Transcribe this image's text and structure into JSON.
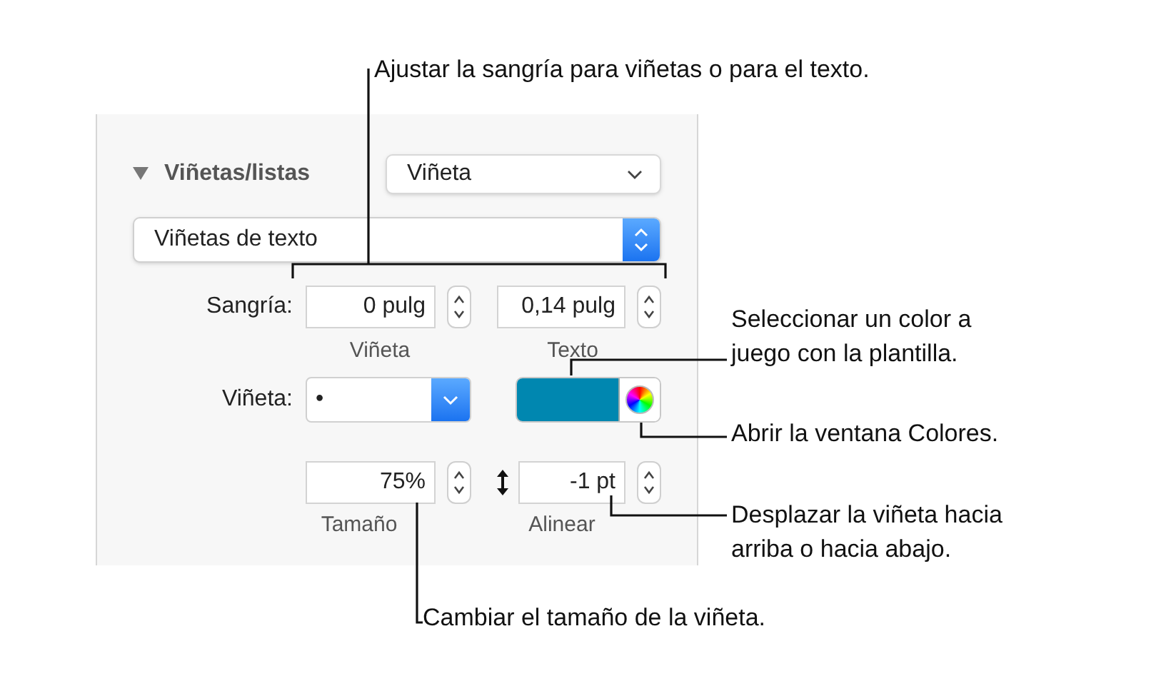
{
  "section": {
    "title": "Viñetas/listas",
    "expanded": true,
    "style_popup": "Viñeta"
  },
  "bullet_type": "Viñetas de texto",
  "indent": {
    "label": "Sangría:",
    "fields": [
      {
        "value": "0 pulg",
        "caption": "Viñeta"
      },
      {
        "value": "0,14 pulg",
        "caption": "Texto"
      }
    ]
  },
  "bullet": {
    "label": "Viñeta:",
    "value": "•",
    "color": "#0087b0"
  },
  "size": {
    "value": "75%",
    "caption": "Tamaño"
  },
  "align": {
    "value": "-1 pt",
    "caption": "Alinear"
  },
  "callouts": [
    "Ajustar la sangría para viñetas o para el texto.",
    "Seleccionar un color a juego con la plantilla.",
    "Abrir la ventana Colores.",
    "Desplazar la viñeta hacia arriba o hacia abajo.",
    "Cambiar el tamaño de la viñeta."
  ]
}
